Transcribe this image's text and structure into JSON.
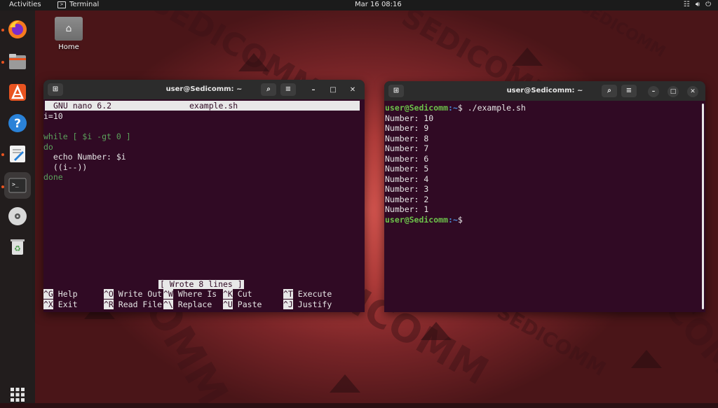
{
  "topbar": {
    "activities": "Activities",
    "app_name": "Terminal",
    "clock": "Mar 16  08:16"
  },
  "desktop": {
    "home_label": "Home",
    "watermark": "SEDICOMM"
  },
  "nano_window": {
    "title": "user@Sedicomm: ~",
    "header_app": "GNU nano 6.2",
    "header_file": "example.sh",
    "lines": [
      "i=10",
      "",
      "while [ $i -gt 0 ]",
      "do",
      "  echo Number: $i",
      "  ((i--))",
      "done"
    ],
    "status": "[ Wrote 8 lines ]",
    "shortcuts_row1": [
      {
        "key": "^G",
        "label": "Help"
      },
      {
        "key": "^O",
        "label": "Write Out"
      },
      {
        "key": "^W",
        "label": "Where Is"
      },
      {
        "key": "^K",
        "label": "Cut"
      },
      {
        "key": "^T",
        "label": "Execute"
      }
    ],
    "shortcuts_row2": [
      {
        "key": "^X",
        "label": "Exit"
      },
      {
        "key": "^R",
        "label": "Read File"
      },
      {
        "key": "^\\",
        "label": "Replace"
      },
      {
        "key": "^U",
        "label": "Paste"
      },
      {
        "key": "^J",
        "label": "Justify"
      }
    ]
  },
  "term_window": {
    "title": "user@Sedicomm: ~",
    "prompt_user": "user@Sedicomm",
    "prompt_path": ":~",
    "prompt_symbol": "$",
    "command": " ./example.sh",
    "output": [
      "Number: 10",
      "Number: 9",
      "Number: 8",
      "Number: 7",
      "Number: 6",
      "Number: 5",
      "Number: 4",
      "Number: 3",
      "Number: 2",
      "Number: 1"
    ]
  },
  "dock": {
    "items": [
      "firefox-icon",
      "files-icon",
      "app-center-icon",
      "help-icon",
      "text-editor-icon",
      "terminal-icon",
      "disc-icon",
      "trash-icon",
      "show-apps-icon"
    ]
  },
  "colors": {
    "terminal_bg": "#300a24",
    "accent": "#e95420",
    "prompt_green": "#6cc04a",
    "path_blue": "#4a8ad8"
  }
}
